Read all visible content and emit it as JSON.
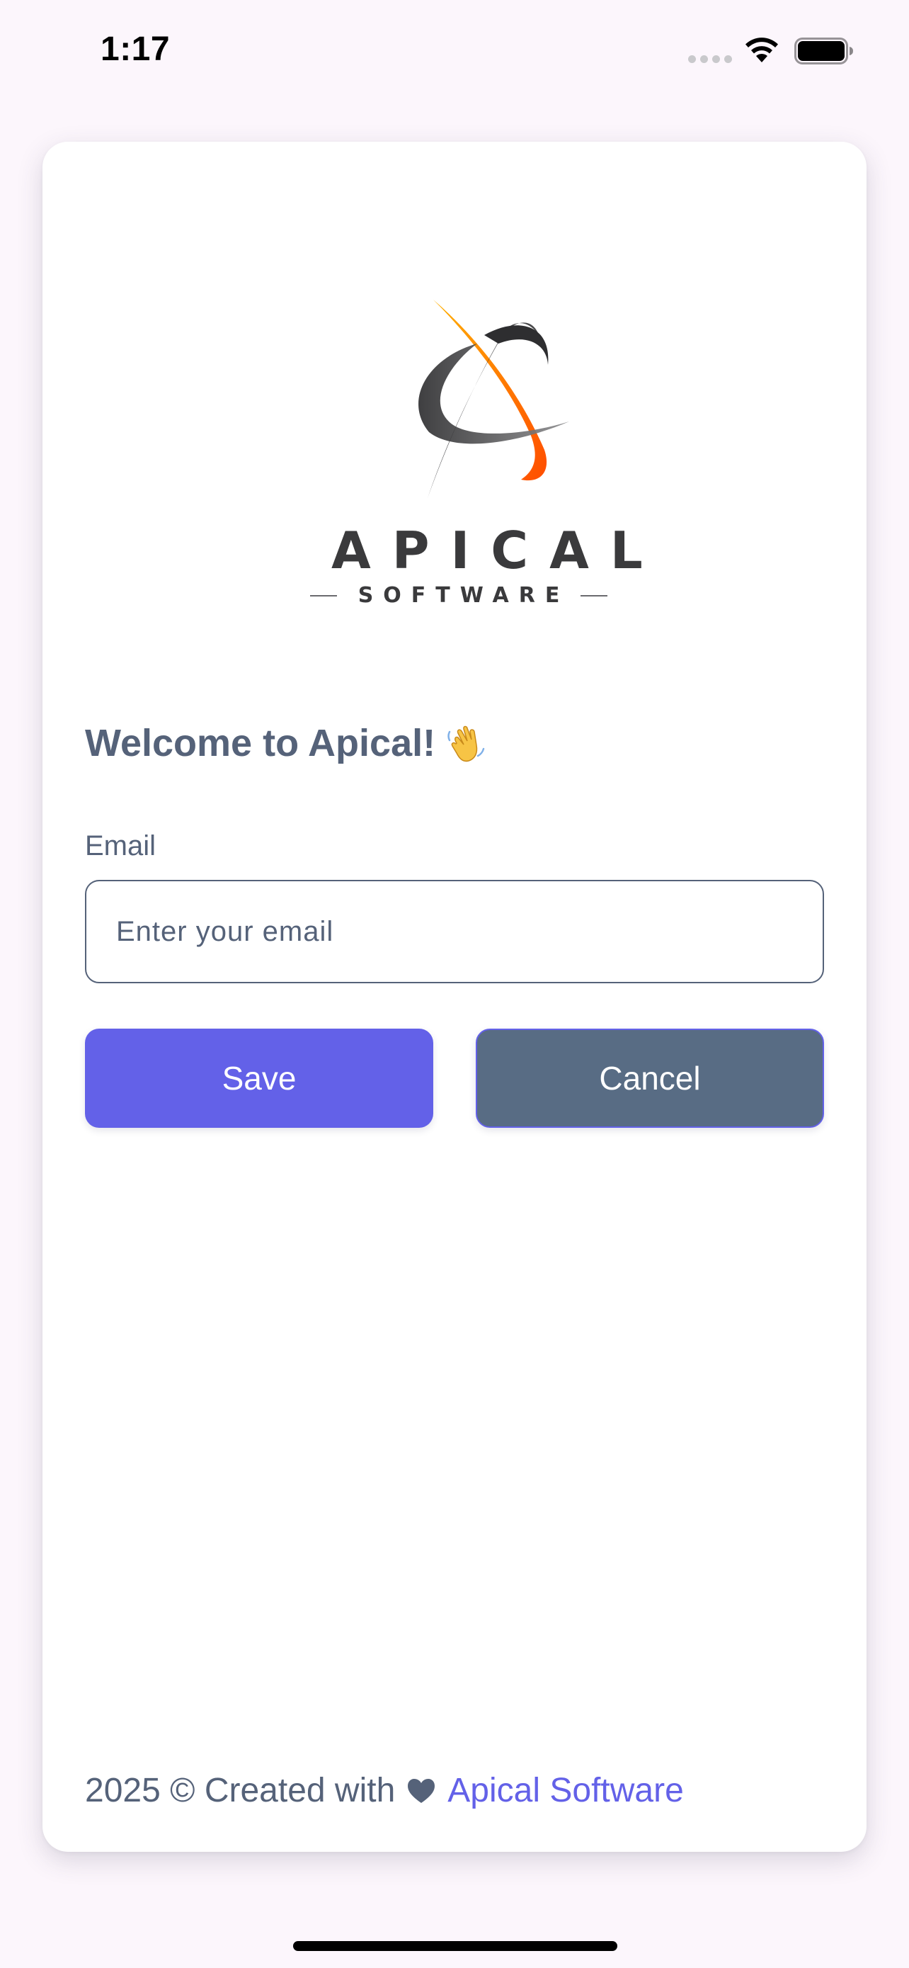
{
  "status_bar": {
    "time": "1:17"
  },
  "logo": {
    "wordmark": "APICAL",
    "subtitle": "SOFTWARE",
    "colors": {
      "orange": "#ff7a00",
      "dark": "#3a3a3c"
    }
  },
  "form": {
    "welcome_text": "Welcome to Apical!",
    "welcome_icon": "waving-hand-icon",
    "email_label": "Email",
    "email_placeholder": "Enter your email",
    "email_value": "",
    "save_label": "Save",
    "cancel_label": "Cancel"
  },
  "footer": {
    "prefix": "2025 © Created with",
    "heart_icon": "heart-icon",
    "link_text": "Apical Software"
  },
  "colors": {
    "primary": "#6361e8",
    "secondary": "#586c84",
    "text": "#556279",
    "background": "#fcf6fc"
  }
}
